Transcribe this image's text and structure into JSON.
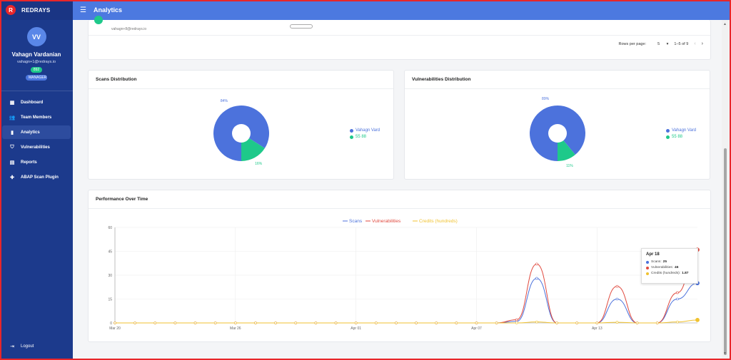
{
  "app": {
    "brand_letter": "R",
    "brand_name": "REDRAYS",
    "accent": "#4c79e0",
    "sidebar_color": "#1c3a8c"
  },
  "user": {
    "initials": "VV",
    "name": "Vahagn Vardanian",
    "email": "vahagn+1@redrays.io",
    "id_badge": "892",
    "role": "MANAGER"
  },
  "nav": [
    {
      "label": "Dashboard",
      "icon": "dashboard-icon",
      "glyph": "▦"
    },
    {
      "label": "Team Members",
      "icon": "team-icon",
      "glyph": "👥"
    },
    {
      "label": "Analytics",
      "icon": "analytics-icon",
      "glyph": "▮",
      "active": true
    },
    {
      "label": "Vulnerabilities",
      "icon": "shield-icon",
      "glyph": "⛉"
    },
    {
      "label": "Reports",
      "icon": "reports-icon",
      "glyph": "▤"
    },
    {
      "label": "ABAP Scan Plugin",
      "icon": "puzzle-icon",
      "glyph": "✚"
    }
  ],
  "logout": "Logout",
  "header": {
    "title": "Analytics"
  },
  "table": {
    "partial_email": "vahagn+8@redrays.io",
    "rows_per_page_label": "Rows per page:",
    "rows_per_page_value": "5",
    "range": "1–5 of 9"
  },
  "scans_card": {
    "title": "Scans Distribution"
  },
  "vuln_card": {
    "title": "Vulnerabilities Distribution"
  },
  "perf_card": {
    "title": "Performance Over Time"
  },
  "chart_data": [
    {
      "type": "pie",
      "title": "Scans Distribution",
      "labels": [
        "Vahagn Vard",
        "55 88"
      ],
      "values": [
        84,
        16
      ],
      "value_labels": [
        "84%",
        "16%"
      ],
      "colors": [
        "#4c72dc",
        "#1ec98a"
      ]
    },
    {
      "type": "pie",
      "title": "Vulnerabilities Distribution",
      "labels": [
        "Vahagn Vard",
        "55 88"
      ],
      "values": [
        89,
        11
      ],
      "value_labels": [
        "89%",
        "11%"
      ],
      "colors": [
        "#4c72dc",
        "#1ec98a"
      ]
    },
    {
      "type": "line",
      "title": "Performance Over Time",
      "x": [
        "Mar 20",
        "Mar 21",
        "Mar 22",
        "Mar 23",
        "Mar 24",
        "Mar 25",
        "Mar 26",
        "Mar 27",
        "Mar 28",
        "Mar 29",
        "Mar 30",
        "Mar 31",
        "Apr 01",
        "Apr 02",
        "Apr 03",
        "Apr 04",
        "Apr 05",
        "Apr 06",
        "Apr 07",
        "Apr 08",
        "Apr 09",
        "Apr 10",
        "Apr 11",
        "Apr 12",
        "Apr 13",
        "Apr 14",
        "Apr 15",
        "Apr 16",
        "Apr 17",
        "Apr 18"
      ],
      "xticks": [
        "Mar 20",
        "Mar 26",
        "Apr 01",
        "Apr 07",
        "Apr 13"
      ],
      "yticks": [
        0,
        15,
        30,
        45,
        60
      ],
      "ylim": [
        0,
        60
      ],
      "grid": true,
      "legend_position": "top",
      "series": [
        {
          "name": "Scans",
          "color": "#4c72dc",
          "values": [
            0,
            0,
            0,
            0,
            0,
            0,
            0,
            0,
            0,
            0,
            0,
            0,
            0,
            0,
            0,
            0,
            0,
            0,
            0,
            0,
            1,
            28,
            0,
            0,
            0,
            15,
            0,
            0,
            15,
            25
          ]
        },
        {
          "name": "Vulnerabilities",
          "color": "#e04a3f",
          "values": [
            0,
            0,
            0,
            0,
            0,
            0,
            0,
            0,
            0,
            0,
            0,
            0,
            0,
            0,
            0,
            0,
            0,
            0,
            0,
            0,
            2,
            37,
            0,
            0,
            0,
            23,
            0,
            0,
            19,
            46
          ]
        },
        {
          "name": "Credits (hundreds)",
          "color": "#f0c230",
          "values": [
            0,
            0,
            0,
            0,
            0,
            0,
            0,
            0,
            0,
            0,
            0,
            0,
            0,
            0,
            0,
            0,
            0,
            0,
            0,
            0,
            0,
            0.6,
            0,
            0,
            0,
            0.4,
            0,
            0,
            0.6,
            1.87
          ]
        }
      ]
    }
  ],
  "tooltip": {
    "title": "Apr 18",
    "rows": [
      {
        "label": "Scans:",
        "value": "25",
        "color": "#4c72dc"
      },
      {
        "label": "Vulnerabilities:",
        "value": "46",
        "color": "#e04a3f"
      },
      {
        "label": "Credits (hundreds):",
        "value": "1.87",
        "color": "#f0c230"
      }
    ]
  }
}
